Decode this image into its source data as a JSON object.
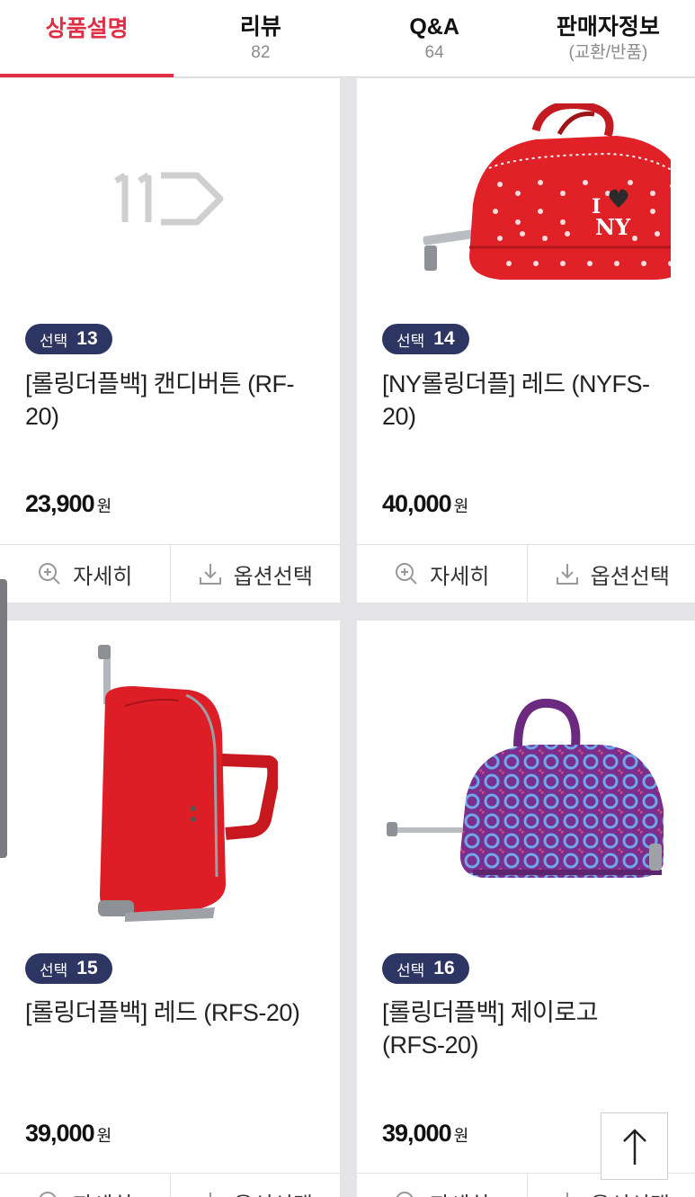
{
  "tabs": [
    {
      "label": "상품설명",
      "sub": "",
      "active": true
    },
    {
      "label": "리뷰",
      "sub": "82",
      "active": false
    },
    {
      "label": "Q&A",
      "sub": "64",
      "active": false
    },
    {
      "label": "판매자정보",
      "sub": "(교환/반품)",
      "active": false
    }
  ],
  "products": [
    {
      "badge_label": "선택",
      "badge_no": "13",
      "title": "[롤링더플백] 캔디버튼 (RF-20)",
      "price": "23,900",
      "currency": "원",
      "image": "11st-logo-placeholder"
    },
    {
      "badge_label": "선택",
      "badge_no": "14",
      "title": "[NY롤링더플] 레드 (NYFS-20)",
      "price": "40,000",
      "currency": "원",
      "image": "red-polka-dot-duffle"
    },
    {
      "badge_label": "선택",
      "badge_no": "15",
      "title": "[롤링더플백] 레드 (RFS-20)",
      "price": "39,000",
      "currency": "원",
      "image": "red-rolling-duffle-side"
    },
    {
      "badge_label": "선택",
      "badge_no": "16",
      "title": "[롤링더플백] 제이로고 (RFS-20)",
      "price": "39,000",
      "currency": "원",
      "image": "purple-pattern-duffle"
    }
  ],
  "actions": {
    "detail": "자세히",
    "option": "옵션선택"
  },
  "colors": {
    "accent": "#e02e46",
    "badge": "#2d3563"
  }
}
